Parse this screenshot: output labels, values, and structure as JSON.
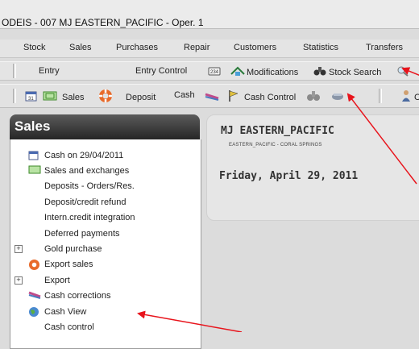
{
  "window": {
    "title": "ODEIS - 007 MJ EASTERN_PACIFIC - Oper. 1"
  },
  "menu": [
    {
      "label": "Stock"
    },
    {
      "label": "Sales"
    },
    {
      "label": "Purchases"
    },
    {
      "label": "Repair"
    },
    {
      "label": "Customers"
    },
    {
      "label": "Statistics"
    },
    {
      "label": "Transfers"
    }
  ],
  "toolbar1": {
    "entry": "Entry",
    "entry_control": "Entry Control",
    "modifications": "Modifications",
    "stock_search": "Stock Search"
  },
  "toolbar2": {
    "sales": "Sales",
    "deposit": "Deposit",
    "cash": "Cash",
    "cash_control": "Cash Control",
    "truncated": "C"
  },
  "sidebar": {
    "title": "Sales",
    "items": [
      {
        "label": "Cash on 29/04/2011"
      },
      {
        "label": "Sales and exchanges"
      },
      {
        "label": "Deposits - Orders/Res."
      },
      {
        "label": "Deposit/credit refund"
      },
      {
        "label": "Intern.credit integration"
      },
      {
        "label": "Deferred payments"
      },
      {
        "label": "Gold purchase"
      },
      {
        "label": "Export sales"
      },
      {
        "label": "Export"
      },
      {
        "label": "Cash corrections"
      },
      {
        "label": "Cash View"
      },
      {
        "label": "Cash control"
      }
    ]
  },
  "main": {
    "company": "MJ EASTERN_PACIFIC",
    "address": "EASTERN_PACIFIC - CORAL SPRINGS",
    "date": "Friday, April 29, 2011"
  },
  "colors": {
    "annotation_arrow": "#e8141c",
    "panel_header": "#333333"
  }
}
